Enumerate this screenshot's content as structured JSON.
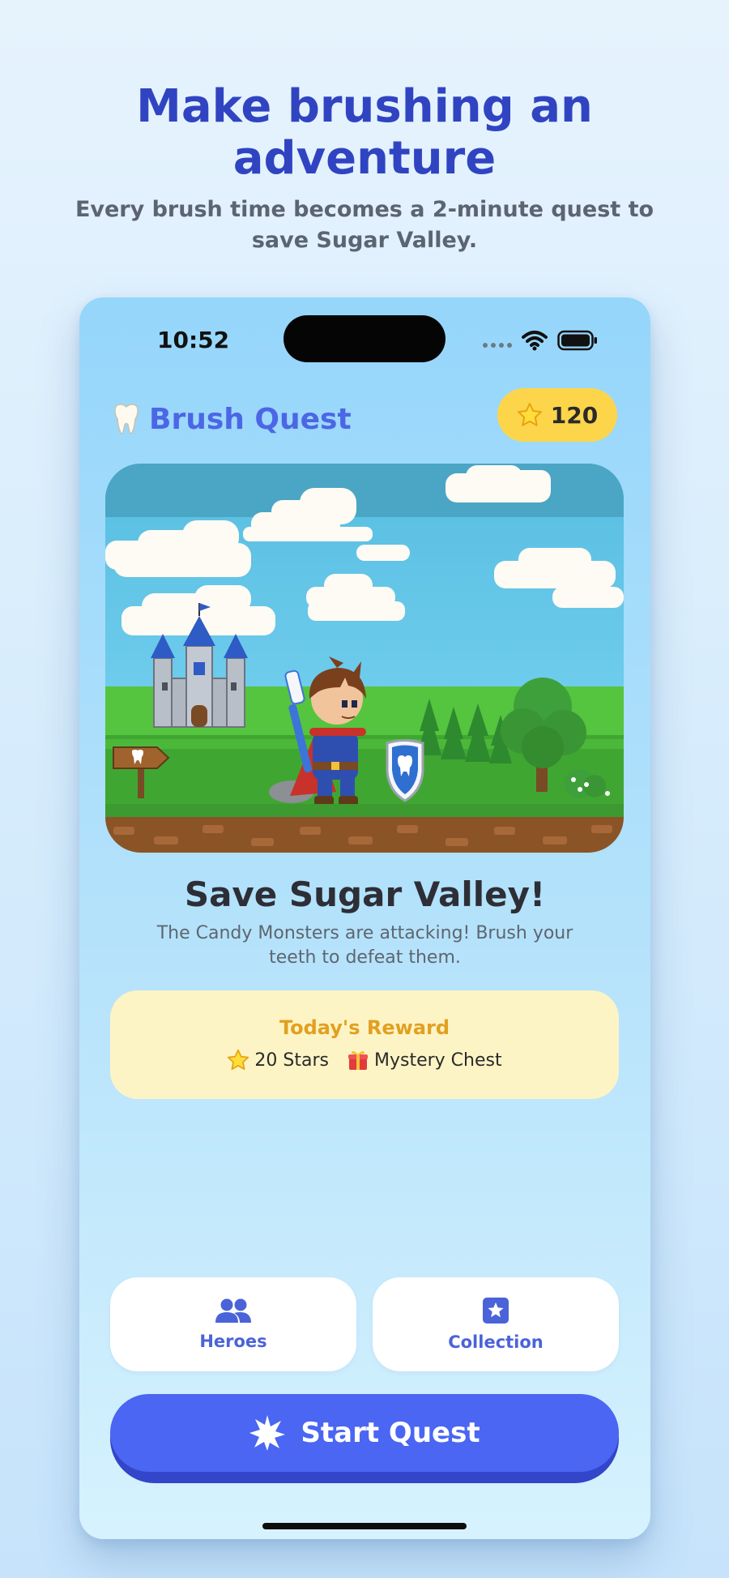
{
  "marketing": {
    "headline": "Make brushing an adventure",
    "subheadline": "Every brush time becomes a 2-minute quest to save Sugar Valley."
  },
  "status_bar": {
    "time": "10:52",
    "icons": [
      "signal-dots-icon",
      "wifi-icon",
      "battery-icon"
    ]
  },
  "app": {
    "title": "Brush Quest",
    "title_icon": "tooth-icon",
    "stars_count": "120",
    "stars_icon": "star-icon"
  },
  "scene": {
    "illustration": "pixel-art hero with toothbrush and shield before a castle in Sugar Valley"
  },
  "quest": {
    "title": "Save Sugar Valley!",
    "description": "The Candy Monsters are attacking! Brush your teeth to defeat them."
  },
  "reward": {
    "title": "Today's Reward",
    "items": [
      {
        "icon": "star-icon",
        "label": "20 Stars"
      },
      {
        "icon": "gift-icon",
        "label": "Mystery Chest"
      }
    ]
  },
  "nav": {
    "heroes": {
      "label": "Heroes",
      "icon": "people-icon"
    },
    "collection": {
      "label": "Collection",
      "icon": "star-badge-icon"
    }
  },
  "actions": {
    "start_quest": "Start Quest",
    "start_icon": "sparkle-burst-icon"
  },
  "colors": {
    "accent": "#4a66f2",
    "headline": "#3044c2",
    "star_pill": "#fdd54a",
    "reward_card": "#fdf4c6",
    "reward_title": "#e2a020"
  }
}
